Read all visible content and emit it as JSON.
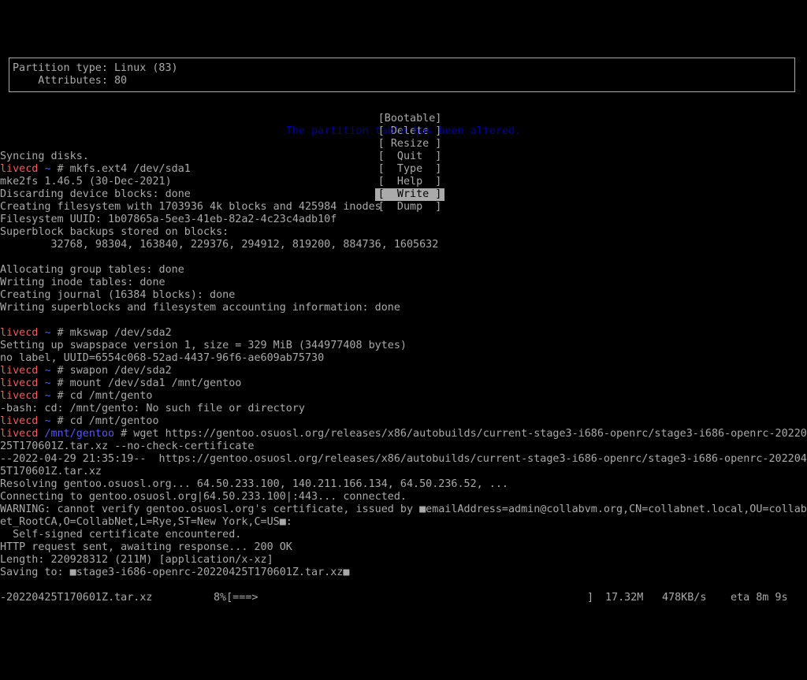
{
  "info": {
    "partition_type": "Partition type: Linux (83)",
    "attributes": "    Attributes: 80"
  },
  "menu": [
    {
      "label": "[Bootable]",
      "selected": false
    },
    {
      "label": "[ Delete ]",
      "selected": false
    },
    {
      "label": "[ Resize ]",
      "selected": false
    },
    {
      "label": "[  Quit  ]",
      "selected": false
    },
    {
      "label": "[  Type  ]",
      "selected": false
    },
    {
      "label": "[  Help  ]",
      "selected": false
    },
    {
      "label": "[  Write ]",
      "selected": true
    },
    {
      "label": "[  Dump  ]",
      "selected": false
    }
  ],
  "status_message": "The partition table has been altered.",
  "terminal": {
    "prompt_host": "livecd",
    "prompt_home": "~",
    "prompt_mnt": "/mnt/gentoo",
    "lines": {
      "l1": "Syncing disks.",
      "l2_cmd": " # mkfs.ext4 /dev/sda1",
      "l3": "mke2fs 1.46.5 (30-Dec-2021)",
      "l4": "Discarding device blocks: done",
      "l5": "Creating filesystem with 1703936 4k blocks and 425984 inodes",
      "l6": "Filesystem UUID: 1b07865a-5ee3-41eb-82a2-4c23c4adb10f",
      "l7": "Superblock backups stored on blocks:",
      "l8": "        32768, 98304, 163840, 229376, 294912, 819200, 884736, 1605632",
      "l9": "Allocating group tables: done",
      "l10": "Writing inode tables: done",
      "l11": "Creating journal (16384 blocks): done",
      "l12": "Writing superblocks and filesystem accounting information: done",
      "l13_cmd": " # mkswap /dev/sda2",
      "l14": "Setting up swapspace version 1, size = 329 MiB (344977408 bytes)",
      "l15": "no label, UUID=6554c068-52ad-4437-96f6-ae609ab75730",
      "l16_cmd": " # swapon /dev/sda2",
      "l17_cmd": " # mount /dev/sda1 /mnt/gentoo",
      "l18_cmd": " # cd /mnt/gento",
      "l19": "-bash: cd: /mnt/gento: No such file or directory",
      "l20_cmd": " # cd /mnt/gentoo",
      "l21_cmd": " # wget https://gentoo.osuosl.org/releases/x86/autobuilds/current-stage3-i686-openrc/stage3-i686-openrc-202204",
      "l22": "25T170601Z.tar.xz --no-check-certificate",
      "l23": "--2022-04-29 21:35:19--  https://gentoo.osuosl.org/releases/x86/autobuilds/current-stage3-i686-openrc/stage3-i686-openrc-2022042",
      "l24": "5T170601Z.tar.xz",
      "l25": "Resolving gentoo.osuosl.org... 64.50.233.100, 140.211.166.134, 64.50.236.52, ...",
      "l26": "Connecting to gentoo.osuosl.org|64.50.233.100|:443... connected.",
      "l27": "WARNING: cannot verify gentoo.osuosl.org's certificate, issued by ■emailAddress=admin@collabvm.org,CN=collabnet.local,OU=collabn",
      "l28": "et_RootCA,O=CollabNet,L=Rye,ST=New York,C=US■:",
      "l29": "  Self-signed certificate encountered.",
      "l30": "HTTP request sent, awaiting response... 200 OK",
      "l31": "Length: 220928312 (211M) [application/x-xz]",
      "l32": "Saving to: ■stage3-i686-openrc-20220425T170601Z.tar.xz■"
    }
  },
  "download": {
    "filename": "-20220425T170601Z.tar.xz",
    "percent_text": "8%[===>",
    "bar_end": "]",
    "received": "17.32M",
    "speed": "478KB/s",
    "eta": "eta 8m 9s"
  }
}
